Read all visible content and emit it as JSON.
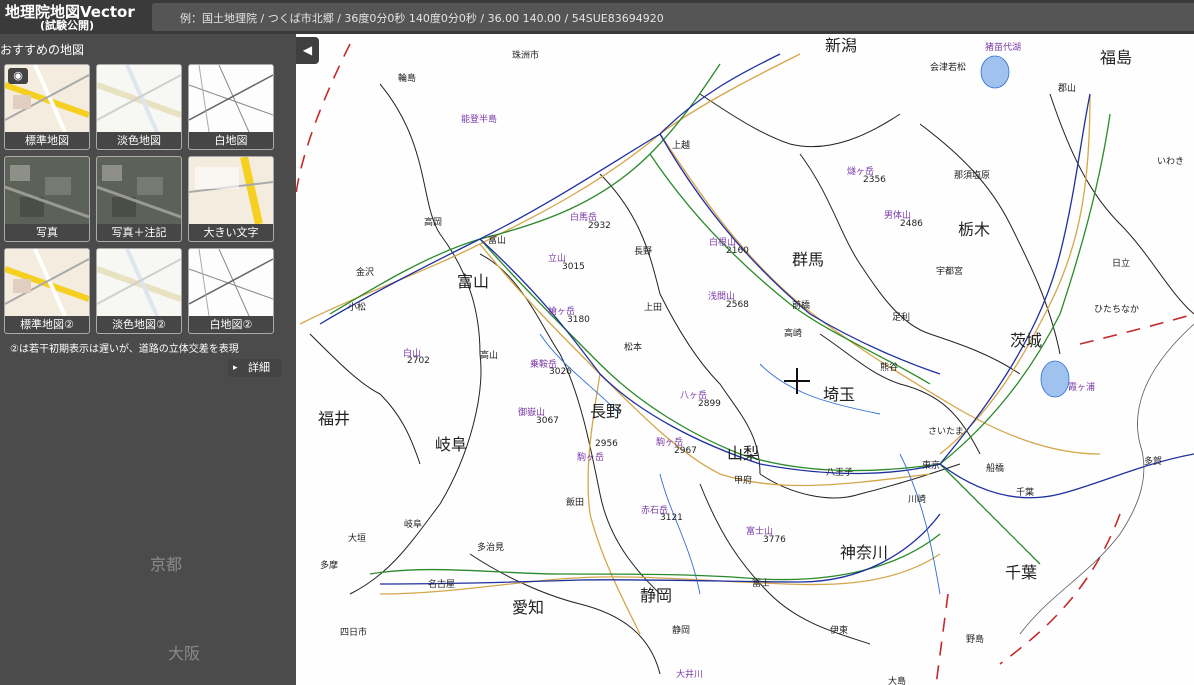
{
  "header": {
    "title": "地理院地図Vector",
    "subtitle": "(試験公開)",
    "search_placeholder": "例：国土地理院 / つくば市北郷 / 36度0分0秒 140度0分0秒 / 36.00 140.00 / 54SUE83694920"
  },
  "panel": {
    "title": "おすすめの地図",
    "tiles": [
      {
        "label": "標準地図",
        "style": "std"
      },
      {
        "label": "淡色地図",
        "style": "pale"
      },
      {
        "label": "白地図",
        "style": "blank"
      },
      {
        "label": "写真",
        "style": "photo"
      },
      {
        "label": "写真＋注記",
        "style": "photo"
      },
      {
        "label": "大きい文字",
        "style": "big"
      },
      {
        "label": "標準地図②",
        "style": "std"
      },
      {
        "label": "淡色地図②",
        "style": "pale"
      },
      {
        "label": "白地図②",
        "style": "blank"
      }
    ],
    "note": "②は若干初期表示は遅いが、道路の立体交差を表現",
    "detail_label": "詳細",
    "dimmed_labels": {
      "kyoto": "京都",
      "osaka": "大阪"
    }
  },
  "map": {
    "prefectures": {
      "niigata": "新潟",
      "fukushima": "福島",
      "toyama": "富山",
      "gunma": "群馬",
      "tochigi": "栃木",
      "ibaraki": "茨城",
      "nagano": "長野",
      "saitama": "埼玉",
      "fukui": "福井",
      "gifu": "岐阜",
      "yamanashi": "山梨",
      "kanagawa": "神奈川",
      "chiba": "千葉",
      "aichi": "愛知",
      "shizuoka": "静岡"
    },
    "cities": {
      "wajima": "輪島",
      "noto": "能登半島",
      "takaoka": "高岡",
      "toyama_c": "富山",
      "kanazawa": "金沢",
      "komatsu": "小松",
      "shirayama": "白山",
      "takayama": "高山",
      "joetsu": "上越",
      "nagano_c": "長野",
      "ueda": "上田",
      "matsumoto": "松本",
      "iida": "飯田",
      "gifu_c": "岐阜",
      "ogaki": "大垣",
      "tajimi": "多治見",
      "nagoya": "名古屋",
      "yokkaichi": "四日市",
      "aizu": "会津若松",
      "koriyama": "郡山",
      "iwaki": "いわき",
      "nasu": "那須塩原",
      "utsunomiya": "宇都宮",
      "hitachi": "日立",
      "hitachinaka": "ひたちなか",
      "maebashi": "前橋",
      "takasaki": "高崎",
      "ashikaga": "足利",
      "kumagaya": "熊谷",
      "saitama_c": "さいたま",
      "tokyo": "東京",
      "funabashi": "船橋",
      "chiba_c": "千葉",
      "kawasaki": "川崎",
      "hachioji": "八王子",
      "kofu": "甲府",
      "fuji": "富士",
      "shizuoka_c": "静岡",
      "ito": "伊東",
      "tamago": "珠洲市",
      "oshima": "大島",
      "tama": "多摩",
      "inawashiro": "猪苗代湖",
      "kasumigaura": "霞ヶ浦",
      "nojima": "野島",
      "oigawa": "大井川",
      "taka": "多賀"
    },
    "mountains": {
      "shirouma": "白馬岳",
      "tateyama": "立山",
      "yarigatake": "槍ヶ岳",
      "norikura": "乗鞍岳",
      "ontake": "御嶽山",
      "komagatake": "駒ヶ岳",
      "haku": "白山",
      "hiuchi": "燧ヶ岳",
      "nantai": "男体山",
      "shirane": "白根山",
      "asama": "浅間山",
      "yatsugatake": "八ヶ岳",
      "koma2": "駒ヶ岳",
      "akaishi": "赤石岳",
      "fuji": "富士山"
    },
    "elevations": {
      "shirouma": "2932",
      "tateyama": "3015",
      "yarigatake": "3180",
      "norikura": "3026",
      "ontake": "3067",
      "komagatake": "2956",
      "haku": "2702",
      "hiuchi": "2356",
      "nantai": "2486",
      "shirane": "2160",
      "asama": "2568",
      "yatsugatake": "2899",
      "koma2": "2967",
      "akaishi": "3121",
      "fuji": "3776"
    },
    "colors": {
      "national_road": "#d4a64a",
      "expressway": "#2a8a2a",
      "railway": "#1f2fa0",
      "pref_border": "#222222",
      "water": "#2f6fd6",
      "eez": "#c42a2a"
    }
  }
}
